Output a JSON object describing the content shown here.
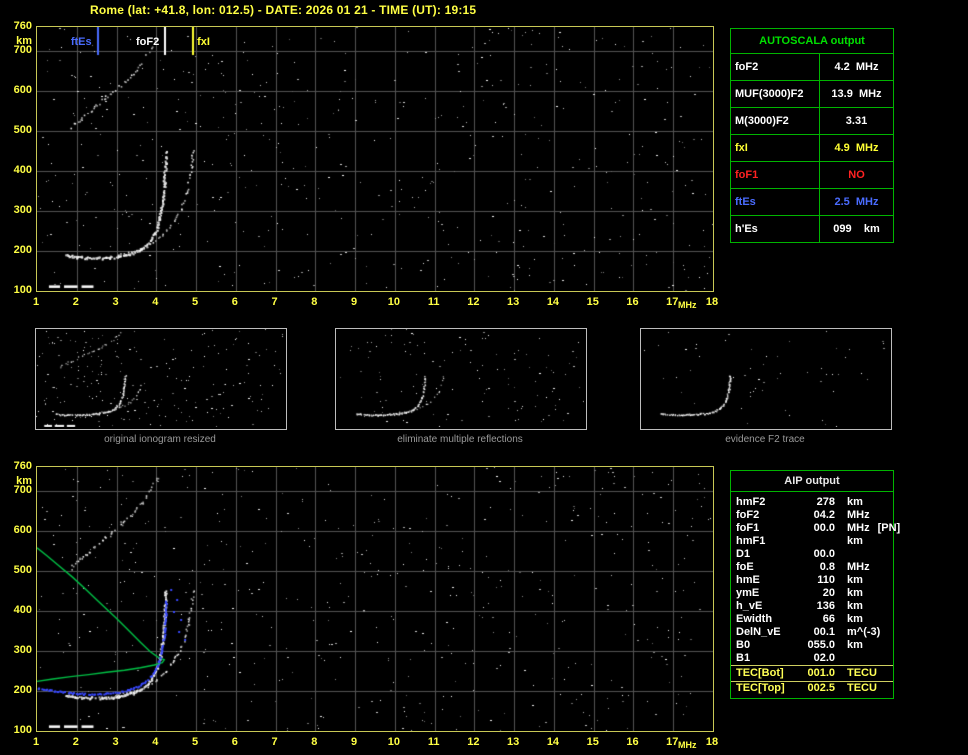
{
  "title": "Rome (lat: +41.8, lon: 012.5) - DATE: 2026 01 21 - TIME (UT): 19:15",
  "axes": {
    "y_ticks": [
      760,
      700,
      600,
      500,
      400,
      300,
      200,
      100
    ],
    "y_unit": "km",
    "x_ticks": [
      1,
      2,
      3,
      4,
      5,
      6,
      7,
      8,
      9,
      10,
      11,
      12,
      13,
      14,
      15,
      16,
      17,
      18
    ],
    "x_unit": "MHz"
  },
  "markers": [
    {
      "label": "ftEs",
      "f": 2.5,
      "color": "#4a6cff",
      "side": "left"
    },
    {
      "label": "foF2",
      "f": 4.2,
      "color": "#ffffff",
      "side": "left"
    },
    {
      "label": "fxI",
      "f": 4.9,
      "color": "#ffff33",
      "side": "right"
    }
  ],
  "autoscala": {
    "title": "AUTOSCALA output",
    "rows": [
      {
        "label": "foF2",
        "value": "4.2  MHz",
        "color": "#ffffff"
      },
      {
        "label": "MUF(3000)F2",
        "value": "13.9  MHz",
        "color": "#ffffff"
      },
      {
        "label": "M(3000)F2",
        "value": "3.31",
        "color": "#ffffff"
      },
      {
        "label": "fxI",
        "value": "4.9  MHz",
        "color": "#ffff33"
      },
      {
        "label": "foF1",
        "value": "NO",
        "color": "#ff2222"
      },
      {
        "label": "ftEs",
        "value": "2.5  MHz",
        "color": "#4a6cff"
      },
      {
        "label": "h'Es",
        "value": "099    km",
        "color": "#ffffff"
      }
    ]
  },
  "thumbnails": [
    {
      "caption": "original ionogram resized"
    },
    {
      "caption": "eliminate multiple reflections"
    },
    {
      "caption": "evidence F2 trace"
    }
  ],
  "aip": {
    "title": "AIP output",
    "rows": [
      {
        "label": "hmF2",
        "value": "278",
        "unit": "km"
      },
      {
        "label": "foF2",
        "value": "04.2",
        "unit": "MHz"
      },
      {
        "label": "foF1",
        "value": "00.0",
        "unit": "MHz",
        "extra": "[PN]"
      },
      {
        "label": "hmF1",
        "value": "",
        "unit": "km"
      },
      {
        "label": "D1",
        "value": "00.0",
        "unit": ""
      },
      {
        "label": "foE",
        "value": "0.8",
        "unit": "MHz"
      },
      {
        "label": "hmE",
        "value": "110",
        "unit": "km"
      },
      {
        "label": "ymE",
        "value": "20",
        "unit": "km"
      },
      {
        "label": "h_vE",
        "value": "136",
        "unit": "km"
      },
      {
        "label": "Ewidth",
        "value": "66",
        "unit": "km"
      },
      {
        "label": "DelN_vE",
        "value": "00.1",
        "unit": "m^(-3)"
      },
      {
        "label": "B0",
        "value": "055.0",
        "unit": "km"
      },
      {
        "label": "B1",
        "value": "02.0",
        "unit": ""
      },
      {
        "label": "TEC[Bot]",
        "value": "001.0",
        "unit": "TECU",
        "color": "#ffff55",
        "rule": true
      },
      {
        "label": "TEC[Top]",
        "value": "002.5",
        "unit": "TECU",
        "color": "#ffff55"
      }
    ]
  },
  "chart_data": {
    "type": "scatter",
    "title": "Ionogram: virtual height vs sounding frequency",
    "xlabel": "MHz",
    "ylabel": "km",
    "x_range": [
      1,
      18
    ],
    "y_range": [
      100,
      760
    ],
    "grid": true,
    "o_trace": [
      [
        1.7,
        190
      ],
      [
        2.0,
        186
      ],
      [
        2.3,
        184
      ],
      [
        2.6,
        184
      ],
      [
        2.9,
        186
      ],
      [
        3.2,
        191
      ],
      [
        3.5,
        200
      ],
      [
        3.7,
        212
      ],
      [
        3.85,
        228
      ],
      [
        3.97,
        250
      ],
      [
        4.06,
        278
      ],
      [
        4.13,
        315
      ],
      [
        4.18,
        360
      ],
      [
        4.21,
        410
      ],
      [
        4.23,
        455
      ]
    ],
    "x_trace": [
      [
        2.95,
        192
      ],
      [
        3.2,
        195
      ],
      [
        3.5,
        202
      ],
      [
        3.75,
        212
      ],
      [
        3.95,
        225
      ],
      [
        4.15,
        243
      ],
      [
        4.35,
        265
      ],
      [
        4.55,
        295
      ],
      [
        4.7,
        330
      ],
      [
        4.8,
        370
      ],
      [
        4.87,
        415
      ],
      [
        4.91,
        455
      ]
    ],
    "second_order_trace": [
      [
        1.8,
        505
      ],
      [
        2.05,
        528
      ],
      [
        2.35,
        552
      ],
      [
        2.65,
        578
      ],
      [
        2.95,
        605
      ],
      [
        3.25,
        632
      ],
      [
        3.55,
        662
      ],
      [
        3.78,
        692
      ],
      [
        3.95,
        722
      ],
      [
        4.07,
        748
      ]
    ],
    "es_segments": [
      [
        1.3,
        1.58
      ],
      [
        1.68,
        2.02
      ],
      [
        2.12,
        2.42
      ]
    ],
    "es_height": 114,
    "profile_green": [
      [
        1.0,
        558
      ],
      [
        1.25,
        538
      ],
      [
        1.55,
        513
      ],
      [
        1.9,
        484
      ],
      [
        2.25,
        452
      ],
      [
        2.6,
        419
      ],
      [
        2.95,
        386
      ],
      [
        3.3,
        352
      ],
      [
        3.6,
        322
      ],
      [
        3.85,
        298
      ],
      [
        4.05,
        284
      ],
      [
        4.18,
        279
      ],
      [
        4.2,
        278
      ],
      [
        4.15,
        271
      ],
      [
        3.95,
        265
      ],
      [
        3.6,
        258
      ],
      [
        3.2,
        252
      ],
      [
        2.75,
        247
      ],
      [
        2.3,
        241
      ],
      [
        1.85,
        236
      ],
      [
        1.4,
        230
      ],
      [
        1.0,
        224
      ]
    ],
    "fitted_blue": [
      [
        1.0,
        208
      ],
      [
        1.4,
        202
      ],
      [
        1.8,
        197
      ],
      [
        2.2,
        194
      ],
      [
        2.6,
        194
      ],
      [
        2.95,
        197
      ],
      [
        3.25,
        203
      ],
      [
        3.55,
        214
      ],
      [
        3.75,
        228
      ],
      [
        3.92,
        247
      ],
      [
        4.04,
        272
      ],
      [
        4.13,
        305
      ],
      [
        4.19,
        345
      ],
      [
        4.22,
        395
      ],
      [
        4.24,
        440
      ]
    ],
    "blue_scatter": [
      [
        4.35,
        455
      ],
      [
        4.5,
        430
      ],
      [
        4.42,
        400
      ],
      [
        4.6,
        380
      ],
      [
        4.55,
        350
      ],
      [
        4.7,
        330
      ]
    ],
    "colors": {
      "trace": "#ffffff",
      "profile_green": "#00c246",
      "fit_blue": "#3848ff",
      "grid": "#545454"
    }
  }
}
